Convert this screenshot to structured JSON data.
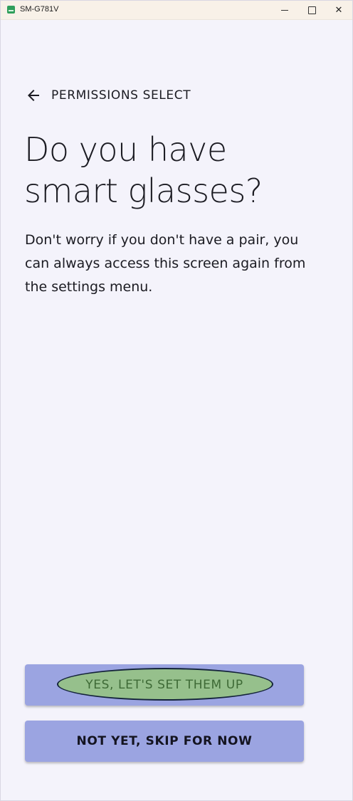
{
  "window": {
    "title": "SM-G781V",
    "minimize_icon": "minimize-icon",
    "maximize_icon": "maximize-icon",
    "close_icon": "close-icon",
    "close_glyph": "✕"
  },
  "header": {
    "back_icon": "arrow-back-icon",
    "title": "PERMISSIONS SELECT"
  },
  "main": {
    "title": "Do you have smart glasses?",
    "description": "Don't worry if you don't have a pair, you can always access this screen again from the settings menu."
  },
  "actions": {
    "yes_label": "YES, LET'S SET THEM UP",
    "skip_label": "NOT YET, SKIP FOR NOW"
  },
  "colors": {
    "background": "#f4f3fb",
    "button": "#9ba4e1",
    "highlight": "#96c08c",
    "titlebar": "#f8f1e8"
  }
}
